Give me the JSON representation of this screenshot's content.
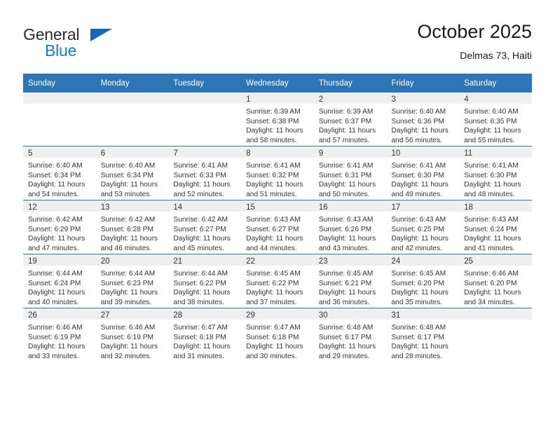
{
  "brand": {
    "name_part1": "General",
    "name_part2": "Blue",
    "accent_color": "#1b76c6",
    "header_color": "#2f75b5"
  },
  "header": {
    "title": "October 2025",
    "subtitle": "Delmas 73, Haiti"
  },
  "weekday_headers": [
    "Sunday",
    "Monday",
    "Tuesday",
    "Wednesday",
    "Thursday",
    "Friday",
    "Saturday"
  ],
  "weeks": [
    [
      {
        "day": "",
        "sunrise": "",
        "sunset": "",
        "daylight_line1": "",
        "daylight_line2": ""
      },
      {
        "day": "",
        "sunrise": "",
        "sunset": "",
        "daylight_line1": "",
        "daylight_line2": ""
      },
      {
        "day": "",
        "sunrise": "",
        "sunset": "",
        "daylight_line1": "",
        "daylight_line2": ""
      },
      {
        "day": "1",
        "sunrise": "Sunrise: 6:39 AM",
        "sunset": "Sunset: 6:38 PM",
        "daylight_line1": "Daylight: 11 hours",
        "daylight_line2": "and 58 minutes."
      },
      {
        "day": "2",
        "sunrise": "Sunrise: 6:39 AM",
        "sunset": "Sunset: 6:37 PM",
        "daylight_line1": "Daylight: 11 hours",
        "daylight_line2": "and 57 minutes."
      },
      {
        "day": "3",
        "sunrise": "Sunrise: 6:40 AM",
        "sunset": "Sunset: 6:36 PM",
        "daylight_line1": "Daylight: 11 hours",
        "daylight_line2": "and 56 minutes."
      },
      {
        "day": "4",
        "sunrise": "Sunrise: 6:40 AM",
        "sunset": "Sunset: 6:35 PM",
        "daylight_line1": "Daylight: 11 hours",
        "daylight_line2": "and 55 minutes."
      }
    ],
    [
      {
        "day": "5",
        "sunrise": "Sunrise: 6:40 AM",
        "sunset": "Sunset: 6:34 PM",
        "daylight_line1": "Daylight: 11 hours",
        "daylight_line2": "and 54 minutes."
      },
      {
        "day": "6",
        "sunrise": "Sunrise: 6:40 AM",
        "sunset": "Sunset: 6:34 PM",
        "daylight_line1": "Daylight: 11 hours",
        "daylight_line2": "and 53 minutes."
      },
      {
        "day": "7",
        "sunrise": "Sunrise: 6:41 AM",
        "sunset": "Sunset: 6:33 PM",
        "daylight_line1": "Daylight: 11 hours",
        "daylight_line2": "and 52 minutes."
      },
      {
        "day": "8",
        "sunrise": "Sunrise: 6:41 AM",
        "sunset": "Sunset: 6:32 PM",
        "daylight_line1": "Daylight: 11 hours",
        "daylight_line2": "and 51 minutes."
      },
      {
        "day": "9",
        "sunrise": "Sunrise: 6:41 AM",
        "sunset": "Sunset: 6:31 PM",
        "daylight_line1": "Daylight: 11 hours",
        "daylight_line2": "and 50 minutes."
      },
      {
        "day": "10",
        "sunrise": "Sunrise: 6:41 AM",
        "sunset": "Sunset: 6:30 PM",
        "daylight_line1": "Daylight: 11 hours",
        "daylight_line2": "and 49 minutes."
      },
      {
        "day": "11",
        "sunrise": "Sunrise: 6:41 AM",
        "sunset": "Sunset: 6:30 PM",
        "daylight_line1": "Daylight: 11 hours",
        "daylight_line2": "and 48 minutes."
      }
    ],
    [
      {
        "day": "12",
        "sunrise": "Sunrise: 6:42 AM",
        "sunset": "Sunset: 6:29 PM",
        "daylight_line1": "Daylight: 11 hours",
        "daylight_line2": "and 47 minutes."
      },
      {
        "day": "13",
        "sunrise": "Sunrise: 6:42 AM",
        "sunset": "Sunset: 6:28 PM",
        "daylight_line1": "Daylight: 11 hours",
        "daylight_line2": "and 46 minutes."
      },
      {
        "day": "14",
        "sunrise": "Sunrise: 6:42 AM",
        "sunset": "Sunset: 6:27 PM",
        "daylight_line1": "Daylight: 11 hours",
        "daylight_line2": "and 45 minutes."
      },
      {
        "day": "15",
        "sunrise": "Sunrise: 6:43 AM",
        "sunset": "Sunset: 6:27 PM",
        "daylight_line1": "Daylight: 11 hours",
        "daylight_line2": "and 44 minutes."
      },
      {
        "day": "16",
        "sunrise": "Sunrise: 6:43 AM",
        "sunset": "Sunset: 6:26 PM",
        "daylight_line1": "Daylight: 11 hours",
        "daylight_line2": "and 43 minutes."
      },
      {
        "day": "17",
        "sunrise": "Sunrise: 6:43 AM",
        "sunset": "Sunset: 6:25 PM",
        "daylight_line1": "Daylight: 11 hours",
        "daylight_line2": "and 42 minutes."
      },
      {
        "day": "18",
        "sunrise": "Sunrise: 6:43 AM",
        "sunset": "Sunset: 6:24 PM",
        "daylight_line1": "Daylight: 11 hours",
        "daylight_line2": "and 41 minutes."
      }
    ],
    [
      {
        "day": "19",
        "sunrise": "Sunrise: 6:44 AM",
        "sunset": "Sunset: 6:24 PM",
        "daylight_line1": "Daylight: 11 hours",
        "daylight_line2": "and 40 minutes."
      },
      {
        "day": "20",
        "sunrise": "Sunrise: 6:44 AM",
        "sunset": "Sunset: 6:23 PM",
        "daylight_line1": "Daylight: 11 hours",
        "daylight_line2": "and 39 minutes."
      },
      {
        "day": "21",
        "sunrise": "Sunrise: 6:44 AM",
        "sunset": "Sunset: 6:22 PM",
        "daylight_line1": "Daylight: 11 hours",
        "daylight_line2": "and 38 minutes."
      },
      {
        "day": "22",
        "sunrise": "Sunrise: 6:45 AM",
        "sunset": "Sunset: 6:22 PM",
        "daylight_line1": "Daylight: 11 hours",
        "daylight_line2": "and 37 minutes."
      },
      {
        "day": "23",
        "sunrise": "Sunrise: 6:45 AM",
        "sunset": "Sunset: 6:21 PM",
        "daylight_line1": "Daylight: 11 hours",
        "daylight_line2": "and 36 minutes."
      },
      {
        "day": "24",
        "sunrise": "Sunrise: 6:45 AM",
        "sunset": "Sunset: 6:20 PM",
        "daylight_line1": "Daylight: 11 hours",
        "daylight_line2": "and 35 minutes."
      },
      {
        "day": "25",
        "sunrise": "Sunrise: 6:46 AM",
        "sunset": "Sunset: 6:20 PM",
        "daylight_line1": "Daylight: 11 hours",
        "daylight_line2": "and 34 minutes."
      }
    ],
    [
      {
        "day": "26",
        "sunrise": "Sunrise: 6:46 AM",
        "sunset": "Sunset: 6:19 PM",
        "daylight_line1": "Daylight: 11 hours",
        "daylight_line2": "and 33 minutes."
      },
      {
        "day": "27",
        "sunrise": "Sunrise: 6:46 AM",
        "sunset": "Sunset: 6:19 PM",
        "daylight_line1": "Daylight: 11 hours",
        "daylight_line2": "and 32 minutes."
      },
      {
        "day": "28",
        "sunrise": "Sunrise: 6:47 AM",
        "sunset": "Sunset: 6:18 PM",
        "daylight_line1": "Daylight: 11 hours",
        "daylight_line2": "and 31 minutes."
      },
      {
        "day": "29",
        "sunrise": "Sunrise: 6:47 AM",
        "sunset": "Sunset: 6:18 PM",
        "daylight_line1": "Daylight: 11 hours",
        "daylight_line2": "and 30 minutes."
      },
      {
        "day": "30",
        "sunrise": "Sunrise: 6:48 AM",
        "sunset": "Sunset: 6:17 PM",
        "daylight_line1": "Daylight: 11 hours",
        "daylight_line2": "and 29 minutes."
      },
      {
        "day": "31",
        "sunrise": "Sunrise: 6:48 AM",
        "sunset": "Sunset: 6:17 PM",
        "daylight_line1": "Daylight: 11 hours",
        "daylight_line2": "and 28 minutes."
      },
      {
        "day": "",
        "sunrise": "",
        "sunset": "",
        "daylight_line1": "",
        "daylight_line2": ""
      }
    ]
  ]
}
